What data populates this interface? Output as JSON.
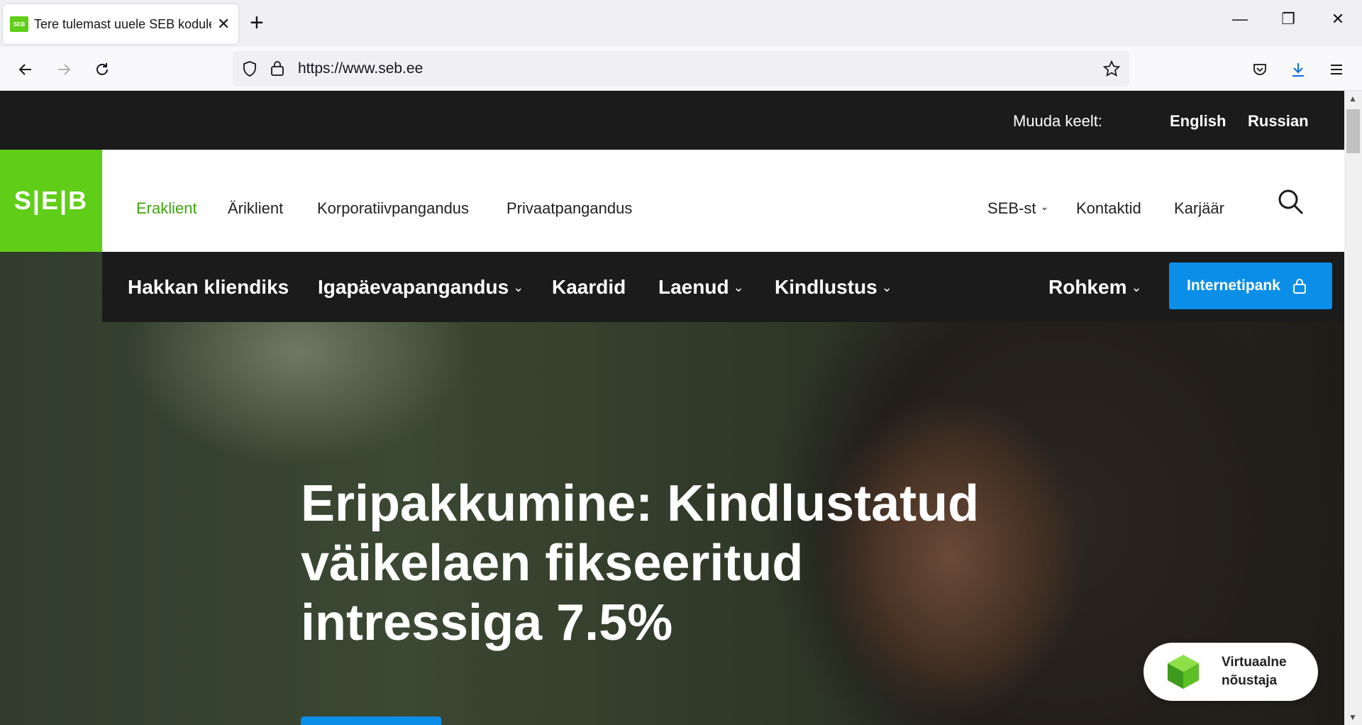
{
  "browser": {
    "tab_title": "Tere tulemast uuele SEB koduleheküljele",
    "tab_favicon_text": "SEB",
    "url": "https://www.seb.ee"
  },
  "topbar": {
    "lang_label": "Muuda keelt:",
    "languages": [
      "English",
      "Russian"
    ]
  },
  "mainnav": {
    "logo_text": "S|E|B",
    "segments": [
      "Eraklient",
      "Äriklient",
      "Korporatiivpangandus",
      "Privaatpangandus"
    ],
    "active_segment": "Eraklient",
    "secondary": [
      "SEB-st",
      "Kontaktid",
      "Karjäär"
    ]
  },
  "subnav": {
    "items": [
      "Hakkan kliendiks",
      "Igapäevapangandus",
      "Kaardid",
      "Laenud",
      "Kindlustus"
    ],
    "more": "Rohkem",
    "cta": "Internetipank"
  },
  "hero": {
    "headline": "Eripakkumine: Kindlustatud väikelaen fikseeritud intressiga 7.5%"
  },
  "advisor": {
    "line1": "Virtuaalne",
    "line2": "nõustaja"
  },
  "colors": {
    "brand_green": "#60cd18",
    "active_green": "#41a410",
    "cta_blue": "#0b8ee8",
    "dark_bar": "#1b1b1b"
  }
}
